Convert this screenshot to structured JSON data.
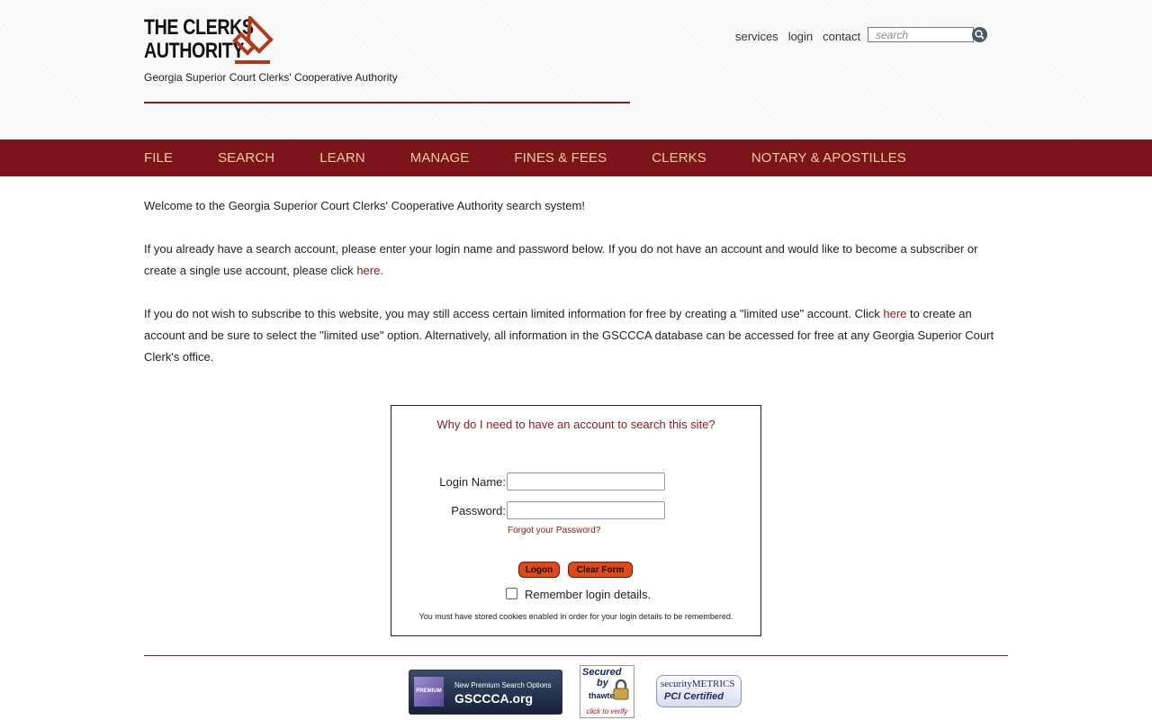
{
  "header": {
    "logo_line1": "THE CLERKS",
    "logo_line2": "AUTHORITY",
    "tagline": "Georgia Superior Court Clerks' Cooperative Authority",
    "links": [
      "services",
      "login",
      "contact"
    ],
    "search_placeholder": "search",
    "search_icon": "magnifier-icon"
  },
  "nav": {
    "items": [
      "FILE",
      "SEARCH",
      "LEARN",
      "MANAGE",
      "FINES & FEES",
      "CLERKS",
      "NOTARY & APOSTILLES"
    ]
  },
  "content": {
    "welcome": "Welcome to the Georgia Superior Court Clerks' Cooperative Authority search system!",
    "p2_before": "If you already have a search account, please enter your login name and password below. If you do not have an account and would like to become a subscriber or create a single use account, please click ",
    "p2_link": "here.",
    "p3_before": "If you do not wish to subscribe to this website, you may still access certain limited information for free by creating a \"limited use\" account. Click ",
    "p3_link": "here",
    "p3_after": " to create an account and be sure to select the \"limited use\" option. Alternatively, all information in the GSCCCA database can be accessed for free at any Georgia Superior Court Clerk's office."
  },
  "login": {
    "why_link": "Why do I need to have an account to search this site?",
    "login_label": "Login Name:",
    "login_value": "",
    "password_label": "Password:",
    "password_value": "",
    "forgot": "Forgot your Password?",
    "logon_button": "Logon",
    "clear_button": "Clear Form",
    "remember_label": "Remember login details.",
    "remember_checked": false,
    "cookie_note": "You must have stored cookies enabled in order for your login details to be remembered."
  },
  "footer": {
    "premium": {
      "square": "PREMIUM",
      "line1": "New Premium Search Options",
      "line2": "GSCCCA.org"
    },
    "thawte": {
      "line1": "Secured",
      "line2": "by",
      "line3": "thawte",
      "line4": "click to verify"
    },
    "pci": {
      "line1": "securityMETRICS",
      "line2": "PCI Certified"
    }
  },
  "colors": {
    "brand": "#7b151b",
    "nav_text": "#f6c9a3",
    "link": "#8a1c24",
    "button": "#e0481a"
  }
}
